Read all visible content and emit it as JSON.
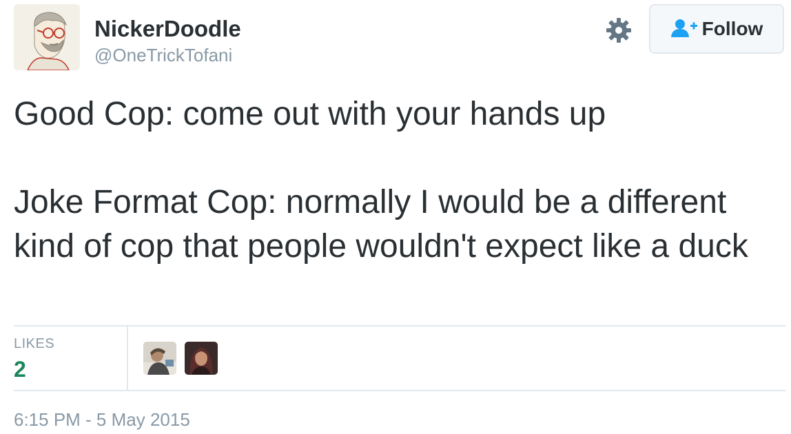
{
  "user": {
    "display_name": "NickerDoodle",
    "handle": "@OneTrickTofani"
  },
  "actions": {
    "settings_icon": "gear-icon",
    "follow_icon": "add-user-icon",
    "follow_label": "Follow"
  },
  "tweet": {
    "line1": "Good Cop: come out with your hands up",
    "line2": "Joke Format Cop: normally I would be a different kind of cop that people wouldn't expect like a duck"
  },
  "stats": {
    "likes_label": "LIKES",
    "likes_count": "2"
  },
  "timestamp": "6:15 PM - 5 May 2015",
  "colors": {
    "text": "#292f33",
    "muted": "#8899a6",
    "likes_count": "#19875a",
    "follow_icon": "#1da1f2",
    "border": "#e1e8ed"
  }
}
